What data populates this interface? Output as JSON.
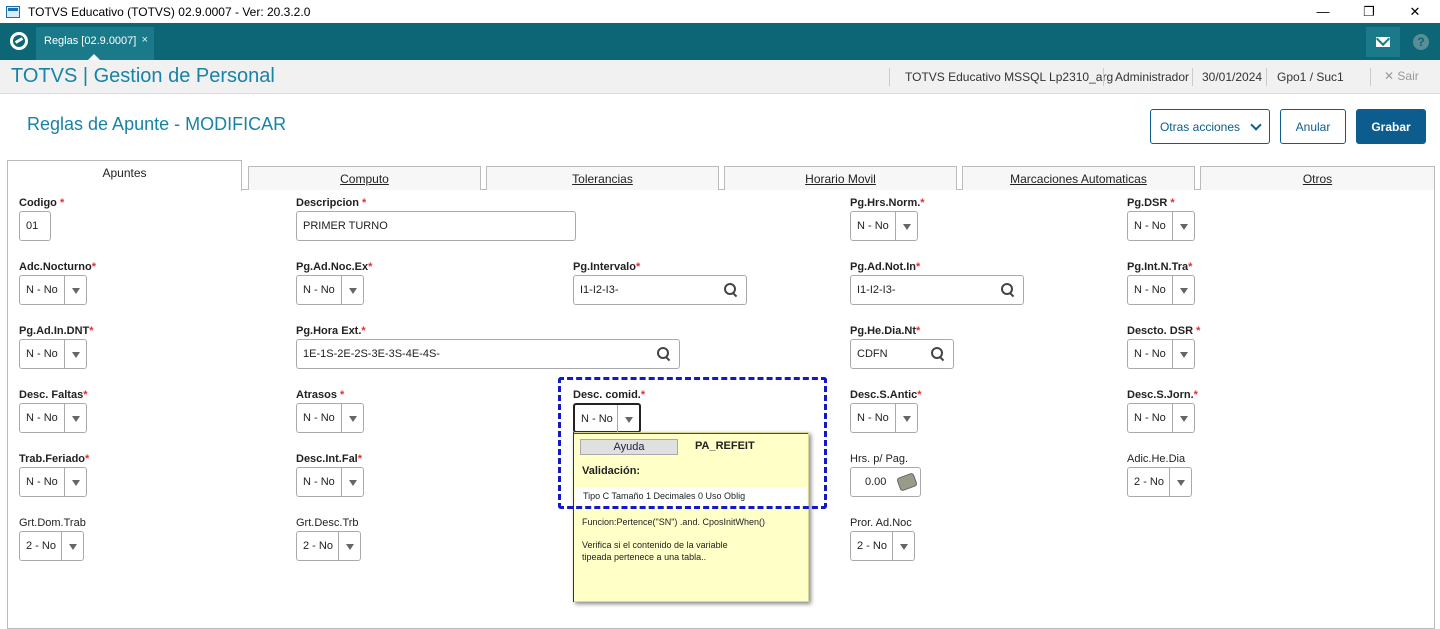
{
  "window": {
    "title": "TOTVS Educativo (TOTVS) 02.9.0007 - Ver: 20.3.2.0",
    "minimize": "—",
    "restore": "❐",
    "close": "✕"
  },
  "tabbar": {
    "tab_label": "Reglas [02.9.0007]",
    "tab_close": "×",
    "help": "?"
  },
  "header": {
    "app_title": "TOTVS | Gestion de Personal",
    "environment": "TOTVS Educativo MSSQL Lp2310_arg",
    "user": "Administrador",
    "date": "30/01/2024",
    "branch": "Gpo1 / Suc1",
    "exit_label": "Sair",
    "exit_icon": "✕"
  },
  "page": {
    "title": "Reglas de Apunte - MODIFICAR",
    "otras_acciones": "Otras acciones",
    "anular": "Anular",
    "grabar": "Grabar"
  },
  "tabs": [
    "Apuntes",
    "Computo",
    "Tolerancias",
    "Horario Movil",
    "Marcaciones Automaticas",
    "Otros"
  ],
  "fields": {
    "codigo": {
      "label": "Codigo",
      "value": "01"
    },
    "descripcion": {
      "label": "Descripcion",
      "value": "PRIMER TURNO"
    },
    "pg_hrs_norm": {
      "label": "Pg.Hrs.Norm.",
      "value": "N - No"
    },
    "pg_dsr": {
      "label": "Pg.DSR",
      "value": "N - No"
    },
    "adc_nocturno": {
      "label": "Adc.Nocturno",
      "value": "N - No"
    },
    "pg_ad_noc_ex": {
      "label": "Pg.Ad.Noc.Ex",
      "value": "N - No"
    },
    "pg_intervalo": {
      "label": "Pg.Intervalo",
      "value": "I1-I2-I3-"
    },
    "pg_ad_not_in": {
      "label": "Pg.Ad.Not.In",
      "value": "I1-I2-I3-"
    },
    "pg_int_n_tra": {
      "label": "Pg.Int.N.Tra",
      "value": "N - No"
    },
    "pg_ad_in_dnt": {
      "label": "Pg.Ad.In.DNT",
      "value": "N - No"
    },
    "pg_hora_ext": {
      "label": "Pg.Hora Ext.",
      "value": "1E-1S-2E-2S-3E-3S-4E-4S-"
    },
    "pg_he_dia_nt": {
      "label": "Pg.He.Dia.Nt",
      "value": "CDFN"
    },
    "descto_dsr": {
      "label": "Descto. DSR",
      "value": "N - No"
    },
    "desc_faltas": {
      "label": "Desc. Faltas",
      "value": "N - No"
    },
    "atrasos": {
      "label": "Atrasos",
      "value": "N - No"
    },
    "desc_comid": {
      "label": "Desc. comid.",
      "value": "N - No"
    },
    "desc_s_antic": {
      "label": "Desc.S.Antic",
      "value": "N - No"
    },
    "desc_s_jorn": {
      "label": "Desc.S.Jorn.",
      "value": "N - No"
    },
    "trab_feriado": {
      "label": "Trab.Feriado",
      "value": "N - No"
    },
    "desc_int_fal": {
      "label": "Desc.Int.Fal",
      "value": "N - No"
    },
    "hrs_p_pag": {
      "label": "Hrs. p/ Pag.",
      "value": "0.00"
    },
    "adic_he_dia": {
      "label": "Adic.He.Dia",
      "value": "2 - No"
    },
    "grt_dom_trab": {
      "label": "Grt.Dom.Trab",
      "value": "2 - No"
    },
    "grt_desc_trb": {
      "label": "Grt.Desc.Trb",
      "value": "2 - No"
    },
    "pror_ad_noc": {
      "label": "Pror. Ad.Noc",
      "value": "2 - No"
    }
  },
  "required_mark": "*",
  "help_popup": {
    "ayuda": "Ayuda",
    "param_name": "PA_REFEIT",
    "validacion": "Validación:",
    "meta": "Tipo C Tamaño   1 Decimales 0  Uso Oblig",
    "funcion": "Funcion:Pertence(\"SN\") .and. CposInitWhen()",
    "description": "Verifica si el contenido de la variable tipeada pertenece a una tabla.."
  }
}
